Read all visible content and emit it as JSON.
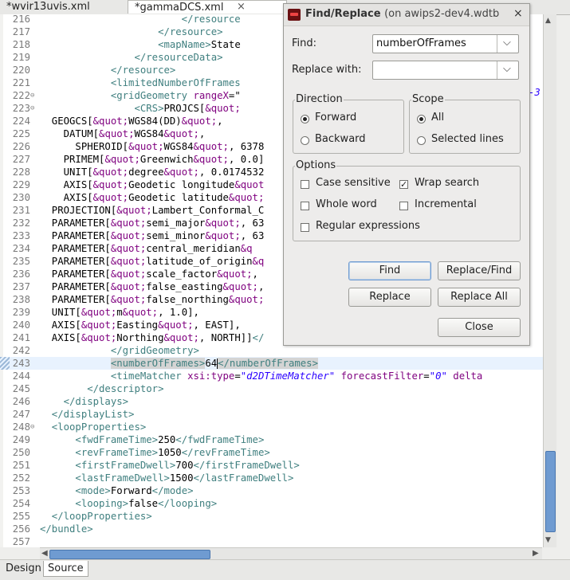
{
  "tabs": [
    {
      "label": "*wvir13uvis.xml"
    },
    {
      "label": "*gammaDCS.xml",
      "close_icon": "×"
    }
  ],
  "editor": {
    "lines": [
      {
        "n": "216",
        "segs": [
          [
            "tag",
            "                        </resource"
          ]
        ]
      },
      {
        "n": "217",
        "segs": [
          [
            "tag",
            "                    </resource>"
          ]
        ]
      },
      {
        "n": "218",
        "segs": [
          [
            "tag",
            "                    <mapName>"
          ],
          [
            "txt",
            "State"
          ]
        ]
      },
      {
        "n": "219",
        "segs": [
          [
            "tag",
            "                </resourceData>"
          ]
        ]
      },
      {
        "n": "220",
        "segs": [
          [
            "tag",
            "            </resource>"
          ]
        ]
      },
      {
        "n": "221",
        "segs": [
          [
            "tag",
            "            <limitedNumberOfFrames"
          ]
        ]
      },
      {
        "n": "222",
        "fold": "⊖",
        "segs": [
          [
            "tag",
            "            <gridGeometry "
          ],
          [
            "attr",
            "rangeX"
          ],
          [
            "txt",
            "=\""
          ]
        ]
      },
      {
        "n": "223",
        "fold": "⊖",
        "segs": [
          [
            "tag",
            "                <CRS>"
          ],
          [
            "txt",
            "PROJCS["
          ],
          [
            "ent",
            "&quot;"
          ]
        ]
      },
      {
        "n": "224",
        "segs": [
          [
            "txt",
            "  GEOGCS["
          ],
          [
            "ent",
            "&quot;"
          ],
          [
            "txt",
            "WGS84(DD)"
          ],
          [
            "ent",
            "&quot;"
          ],
          [
            "txt",
            ","
          ]
        ]
      },
      {
        "n": "225",
        "segs": [
          [
            "txt",
            "    DATUM["
          ],
          [
            "ent",
            "&quot;"
          ],
          [
            "txt",
            "WGS84"
          ],
          [
            "ent",
            "&quot;"
          ],
          [
            "txt",
            ","
          ]
        ]
      },
      {
        "n": "226",
        "segs": [
          [
            "txt",
            "      SPHEROID["
          ],
          [
            "ent",
            "&quot;"
          ],
          [
            "txt",
            "WGS84"
          ],
          [
            "ent",
            "&quot;"
          ],
          [
            "txt",
            ", 6378"
          ]
        ]
      },
      {
        "n": "227",
        "segs": [
          [
            "txt",
            "    PRIMEM["
          ],
          [
            "ent",
            "&quot;"
          ],
          [
            "txt",
            "Greenwich"
          ],
          [
            "ent",
            "&quot;"
          ],
          [
            "txt",
            ", 0.0]"
          ]
        ]
      },
      {
        "n": "228",
        "segs": [
          [
            "txt",
            "    UNIT["
          ],
          [
            "ent",
            "&quot;"
          ],
          [
            "txt",
            "degree"
          ],
          [
            "ent",
            "&quot;"
          ],
          [
            "txt",
            ", 0.0174532"
          ]
        ]
      },
      {
        "n": "229",
        "segs": [
          [
            "txt",
            "    AXIS["
          ],
          [
            "ent",
            "&quot;"
          ],
          [
            "txt",
            "Geodetic longitude"
          ],
          [
            "ent",
            "&quot"
          ]
        ]
      },
      {
        "n": "230",
        "segs": [
          [
            "txt",
            "    AXIS["
          ],
          [
            "ent",
            "&quot;"
          ],
          [
            "txt",
            "Geodetic latitude"
          ],
          [
            "ent",
            "&quot;"
          ]
        ]
      },
      {
        "n": "231",
        "segs": [
          [
            "txt",
            "  PROJECTION["
          ],
          [
            "ent",
            "&quot;"
          ],
          [
            "txt",
            "Lambert_Conformal_C"
          ]
        ]
      },
      {
        "n": "232",
        "segs": [
          [
            "txt",
            "  PARAMETER["
          ],
          [
            "ent",
            "&quot;"
          ],
          [
            "txt",
            "semi_major"
          ],
          [
            "ent",
            "&quot;"
          ],
          [
            "txt",
            ", 63"
          ]
        ]
      },
      {
        "n": "233",
        "segs": [
          [
            "txt",
            "  PARAMETER["
          ],
          [
            "ent",
            "&quot;"
          ],
          [
            "txt",
            "semi_minor"
          ],
          [
            "ent",
            "&quot;"
          ],
          [
            "txt",
            ", 63"
          ]
        ]
      },
      {
        "n": "234",
        "segs": [
          [
            "txt",
            "  PARAMETER["
          ],
          [
            "ent",
            "&quot;"
          ],
          [
            "txt",
            "central_meridian"
          ],
          [
            "ent",
            "&q"
          ]
        ]
      },
      {
        "n": "235",
        "segs": [
          [
            "txt",
            "  PARAMETER["
          ],
          [
            "ent",
            "&quot;"
          ],
          [
            "txt",
            "latitude_of_origin"
          ],
          [
            "ent",
            "&q"
          ]
        ]
      },
      {
        "n": "236",
        "segs": [
          [
            "txt",
            "  PARAMETER["
          ],
          [
            "ent",
            "&quot;"
          ],
          [
            "txt",
            "scale_factor"
          ],
          [
            "ent",
            "&quot;"
          ],
          [
            "txt",
            ", "
          ]
        ]
      },
      {
        "n": "237",
        "segs": [
          [
            "txt",
            "  PARAMETER["
          ],
          [
            "ent",
            "&quot;"
          ],
          [
            "txt",
            "false_easting"
          ],
          [
            "ent",
            "&quot;"
          ],
          [
            "txt",
            ","
          ]
        ]
      },
      {
        "n": "238",
        "segs": [
          [
            "txt",
            "  PARAMETER["
          ],
          [
            "ent",
            "&quot;"
          ],
          [
            "txt",
            "false_northing"
          ],
          [
            "ent",
            "&quot;"
          ]
        ]
      },
      {
        "n": "239",
        "segs": [
          [
            "txt",
            "  UNIT["
          ],
          [
            "ent",
            "&quot;"
          ],
          [
            "txt",
            "m"
          ],
          [
            "ent",
            "&quot;"
          ],
          [
            "txt",
            ", 1.0],"
          ]
        ]
      },
      {
        "n": "240",
        "segs": [
          [
            "txt",
            "  AXIS["
          ],
          [
            "ent",
            "&quot;"
          ],
          [
            "txt",
            "Easting"
          ],
          [
            "ent",
            "&quot;"
          ],
          [
            "txt",
            ", EAST],"
          ]
        ]
      },
      {
        "n": "241",
        "segs": [
          [
            "txt",
            "  AXIS["
          ],
          [
            "ent",
            "&quot;"
          ],
          [
            "txt",
            "Northing"
          ],
          [
            "ent",
            "&quot;"
          ],
          [
            "txt",
            ", NORTH]]"
          ],
          [
            "tag",
            "</"
          ]
        ]
      },
      {
        "n": "242",
        "segs": [
          [
            "tag",
            "            </gridGeometry>"
          ]
        ]
      },
      {
        "n": "243",
        "hl": true,
        "segs": [
          [
            "sp",
            "            "
          ],
          [
            "tagsel",
            "<numberOfFrames>"
          ],
          [
            "txt",
            "64"
          ],
          [
            "caret",
            ""
          ],
          [
            "tagsel",
            "</numberOfFrames>"
          ]
        ]
      },
      {
        "n": "244",
        "segs": [
          [
            "tag",
            "            <timeMatcher "
          ],
          [
            "attr",
            "xsi:type"
          ],
          [
            "txt",
            "="
          ],
          [
            "str",
            "\"d2DTimeMatcher\""
          ],
          [
            "txt",
            " "
          ],
          [
            "attr",
            "forecastFilter"
          ],
          [
            "txt",
            "="
          ],
          [
            "str",
            "\"0\""
          ],
          [
            "txt",
            " "
          ],
          [
            "attr",
            "delta"
          ]
        ]
      },
      {
        "n": "245",
        "segs": [
          [
            "tag",
            "        </descriptor>"
          ]
        ]
      },
      {
        "n": "246",
        "segs": [
          [
            "tag",
            "    </displays>"
          ]
        ]
      },
      {
        "n": "247",
        "segs": [
          [
            "tag",
            "  </displayList>"
          ]
        ]
      },
      {
        "n": "248",
        "fold": "⊖",
        "segs": [
          [
            "tag",
            "  <loopProperties>"
          ]
        ]
      },
      {
        "n": "249",
        "segs": [
          [
            "tag",
            "      <fwdFrameTime>"
          ],
          [
            "txt",
            "250"
          ],
          [
            "tag",
            "</fwdFrameTime>"
          ]
        ]
      },
      {
        "n": "250",
        "segs": [
          [
            "tag",
            "      <revFrameTime>"
          ],
          [
            "txt",
            "1050"
          ],
          [
            "tag",
            "</revFrameTime>"
          ]
        ]
      },
      {
        "n": "251",
        "segs": [
          [
            "tag",
            "      <firstFrameDwell>"
          ],
          [
            "txt",
            "700"
          ],
          [
            "tag",
            "</firstFrameDwell>"
          ]
        ]
      },
      {
        "n": "252",
        "segs": [
          [
            "tag",
            "      <lastFrameDwell>"
          ],
          [
            "txt",
            "1500"
          ],
          [
            "tag",
            "</lastFrameDwell>"
          ]
        ]
      },
      {
        "n": "253",
        "segs": [
          [
            "tag",
            "      <mode>"
          ],
          [
            "txt",
            "Forward"
          ],
          [
            "tag",
            "</mode>"
          ]
        ]
      },
      {
        "n": "254",
        "segs": [
          [
            "tag",
            "      <looping>"
          ],
          [
            "txt",
            "false"
          ],
          [
            "tag",
            "</looping>"
          ]
        ]
      },
      {
        "n": "255",
        "segs": [
          [
            "tag",
            "  </loopProperties>"
          ]
        ]
      },
      {
        "n": "256",
        "segs": [
          [
            "tag",
            "</bundle>"
          ]
        ]
      },
      {
        "n": "257",
        "segs": []
      }
    ],
    "overflow_fragment": "-3"
  },
  "bottom_tabs": [
    {
      "label": "Design"
    },
    {
      "label": "Source"
    }
  ],
  "dialog": {
    "title": "Find/Replace",
    "title_suffix": " (on awips2-dev4.wdtb",
    "close_icon": "×",
    "find_label": "Find:",
    "find_value": "numberOfFrames",
    "replace_label": "Replace with:",
    "replace_value": "",
    "direction_title": "Direction",
    "direction_forward": "Forward",
    "direction_backward": "Backward",
    "scope_title": "Scope",
    "scope_all": "All",
    "scope_selected": "Selected lines",
    "options_title": "Options",
    "opt_case": "Case sensitive",
    "opt_wrap": "Wrap search",
    "opt_whole": "Whole word",
    "opt_incremental": "Incremental",
    "opt_regex": "Regular expressions",
    "btn_find": "Find",
    "btn_replace_find": "Replace/Find",
    "btn_replace": "Replace",
    "btn_replace_all": "Replace All",
    "btn_close": "Close"
  },
  "colors": {
    "tag": "#3f7f7f",
    "attr": "#7f007f",
    "string": "#2a00ff",
    "highlight": "#e8f2fe",
    "scroll_thumb": "#6f9bd1"
  }
}
